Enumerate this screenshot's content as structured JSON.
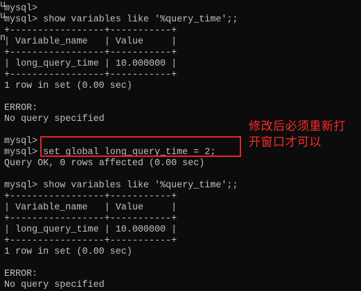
{
  "partial_letters": [
    "u",
    "u",
    "n"
  ],
  "lines": [
    "mysql>",
    "mysql> show variables like '%query_time';;",
    "+-----------------+-----------+",
    "| Variable_name   | Value     |",
    "+-----------------+-----------+",
    "| long_query_time | 10.000000 |",
    "+-----------------+-----------+",
    "1 row in set (0.00 sec)",
    "",
    "ERROR:",
    "No query specified",
    "",
    "mysql>",
    "mysql> set global long_query_time = 2;",
    "Query OK, 0 rows affected (0.00 sec)",
    "",
    "mysql> show variables like '%query_time';;",
    "+-----------------+-----------+",
    "| Variable_name   | Value     |",
    "+-----------------+-----------+",
    "| long_query_time | 10.000000 |",
    "+-----------------+-----------+",
    "1 row in set (0.00 sec)",
    "",
    "ERROR:",
    "No query specified"
  ],
  "annotation": {
    "line1": "修改后必须重新打",
    "line2": "开窗口才可以"
  },
  "colors": {
    "background": "#0c0c0c",
    "text": "#c0c0c0",
    "highlight": "#e8242b"
  }
}
